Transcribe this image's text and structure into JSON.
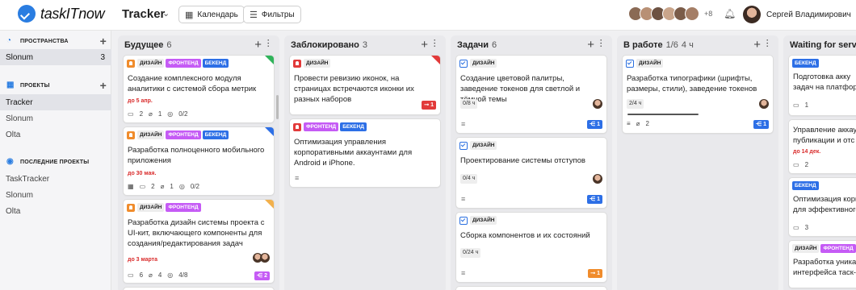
{
  "header": {
    "logo_text": "taskITnow",
    "project": "Tracker",
    "calendar_btn": "Календарь",
    "filters_btn": "Фильтры",
    "more_users": "+8",
    "user_name": "Сергей Владимирович"
  },
  "sidebar": {
    "spaces_title": "ПРОСТРАНСТВА",
    "space_item": {
      "label": "Slonum",
      "count": "3"
    },
    "projects_title": "ПРОЕКТЫ",
    "projects": [
      "Tracker",
      "Slonum",
      "Olta"
    ],
    "recent_title": "ПОСЛЕДНИЕ ПРОЕКТЫ",
    "recent": [
      "TaskTracker",
      "Slonum",
      "Olta"
    ]
  },
  "columns": [
    {
      "title": "Будущее",
      "count": "6",
      "cards": [
        {
          "tags": [
            "ДИЗАЙН",
            "ФРОНТЕНД",
            "БЕКЕНД"
          ],
          "title": "Создание комплексного модуля аналитики с системой сбора метрик",
          "due": "до 5 апр.",
          "meta": [
            "2",
            "1",
            "0/2"
          ]
        },
        {
          "tags": [
            "ДИЗАЙН",
            "ФРОНТЕНД",
            "БЕКЕНД"
          ],
          "title": "Разработка полноценного мобильного приложения",
          "due": "до 30 мая.",
          "meta": [
            "2",
            "1",
            "0/2"
          ]
        },
        {
          "tags": [
            "ДИЗАЙН",
            "ФРОНТЕНД"
          ],
          "title": "Разработка  дизайн системы проекта с UI-кит, включающего компоненты для создания/редактирования задач",
          "due": "до 3 марта",
          "meta": [
            "6",
            "4",
            "4/8"
          ],
          "badge": "2"
        }
      ]
    },
    {
      "title": "Заблокировано",
      "count": "3",
      "cards": [
        {
          "tags": [
            "ДИЗАЙН"
          ],
          "title": "Провести ревизию иконок, на страницах встречаются иконки их разных наборов",
          "badge": "1"
        },
        {
          "tags": [
            "ФРОНТЕНД",
            "БЕКЕНД"
          ],
          "title": "Оптимизация управления корпоративными аккаунтами для Android и iPhone."
        }
      ]
    },
    {
      "title": "Задачи",
      "count": "6",
      "cards": [
        {
          "tags": [
            "ДИЗАЙН"
          ],
          "title": "Создание цветовой палитры, заведение токенов для светлой и тёмной темы",
          "time": "0/8 ч",
          "badge": "1"
        },
        {
          "tags": [
            "ДИЗАЙН"
          ],
          "title": "Проектирование системы отступов",
          "time": "0/4 ч",
          "badge": "1"
        },
        {
          "tags": [
            "ДИЗАЙН"
          ],
          "title": "Сборка компонентов и их состояний",
          "time": "0/24 ч",
          "badge": "1"
        }
      ]
    },
    {
      "title": "В работе",
      "count": "1/6",
      "extra": "4 ч",
      "cards": [
        {
          "tags": [
            "ДИЗАЙН"
          ],
          "title": "Разработка типографики (шрифты, размеры, стили), заведение токенов",
          "time": "2/4 ч",
          "meta": [
            "2"
          ],
          "badge": "1",
          "progress": 0.5
        }
      ]
    },
    {
      "title": "Waiting for serv",
      "cards": [
        {
          "tags": [
            "БЕКЕНД"
          ],
          "title": "Подготовка акку задач на платфор",
          "meta": [
            "1"
          ]
        },
        {
          "title": "Управление аккау публикации и отс",
          "due": "до 14 дек.",
          "meta": [
            "2"
          ]
        },
        {
          "tags": [
            "БЕКЕНД"
          ],
          "title": "Оптимизация корп для эффективного",
          "meta": [
            "3"
          ]
        },
        {
          "tags": [
            "ДИЗАЙН",
            "ФРОНТЕНД"
          ],
          "title": "Разработка уника интерфейса таск-"
        }
      ]
    }
  ],
  "colors": {
    "accent": "#2a7de1",
    "frontend": "#c55bf5",
    "backend": "#2d6fe6",
    "due": "#d92b2b"
  }
}
